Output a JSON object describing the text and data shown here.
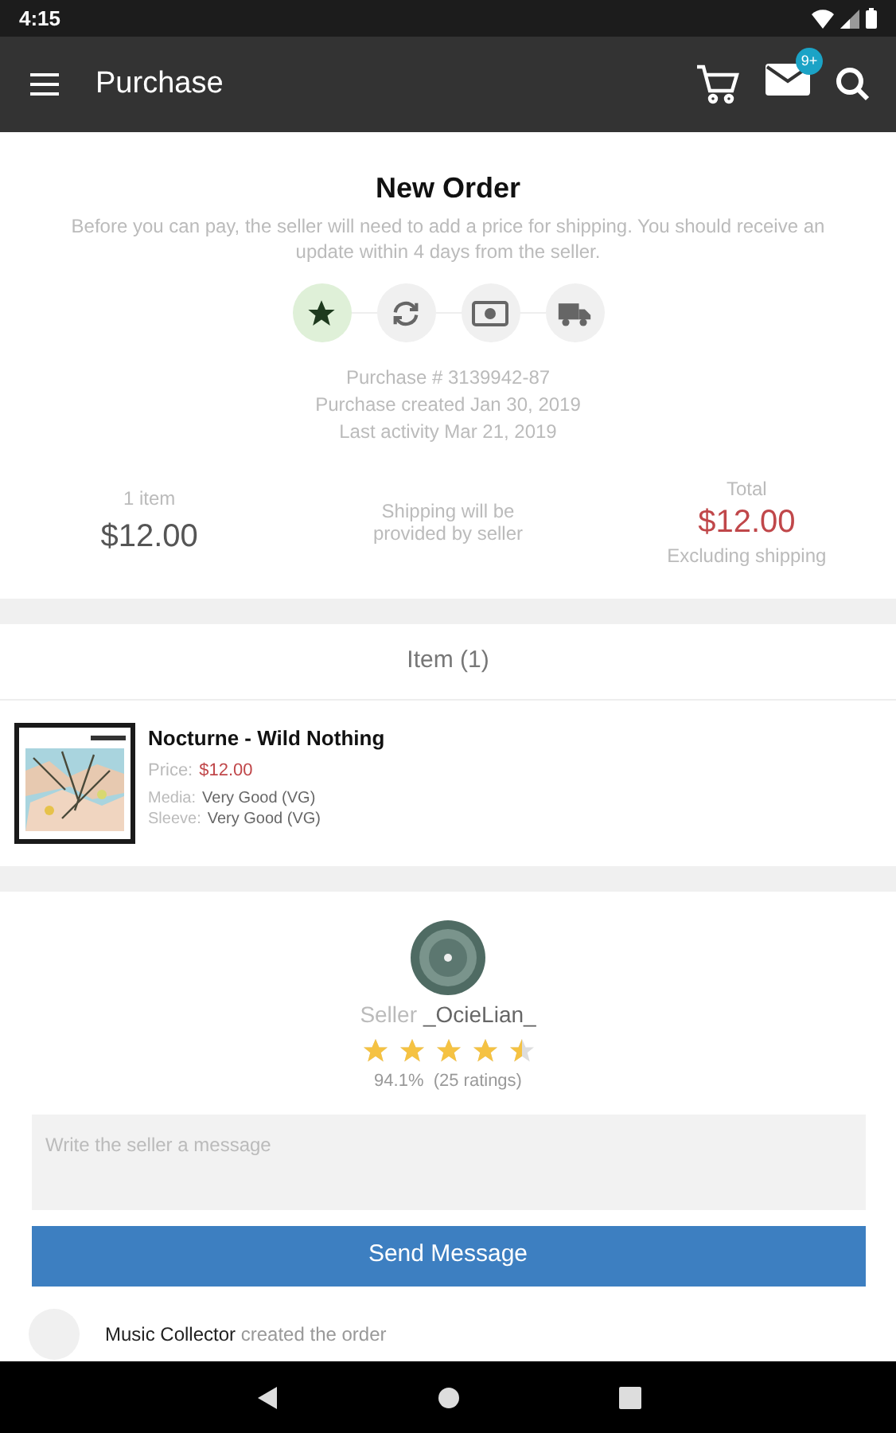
{
  "status_bar": {
    "time": "4:15"
  },
  "app_bar": {
    "title": "Purchase",
    "mail_badge": "9+"
  },
  "order": {
    "title": "New Order",
    "description": "Before you can pay, the seller will need to add a price for shipping. You should receive an update within 4 days from the seller.",
    "steps": [
      {
        "kind": "star",
        "selected": true
      },
      {
        "kind": "refresh",
        "selected": false
      },
      {
        "kind": "money",
        "selected": false
      },
      {
        "kind": "truck",
        "selected": false
      }
    ],
    "details": [
      "Purchase # 3139942-87",
      "Purchase created Jan 30, 2019",
      "Last activity Mar 21, 2019"
    ],
    "summary": {
      "items_label": "1 item",
      "items_price": "$12.00",
      "shipping_note": "Shipping will be provided by seller",
      "total_label": "Total",
      "total": "$12.00",
      "total_note": "Excluding shipping"
    }
  },
  "items": {
    "header": "Item (1)",
    "list": [
      {
        "title": "Nocturne - Wild Nothing",
        "price_label": "Price:",
        "price": "$12.00",
        "media_label": "Media:",
        "media": "Very Good (VG)",
        "sleeve_label": "Sleeve:",
        "sleeve": "Very Good (VG)"
      }
    ]
  },
  "seller": {
    "label": "Seller",
    "name": "_OcieLian_",
    "stars": 4.5,
    "rating": "94.1%  (25 ratings)",
    "message_placeholder": "Write the seller a message",
    "send_button": "Send Message"
  },
  "activity": [
    {
      "actor": "Music Collector",
      "text": "created the order"
    }
  ]
}
